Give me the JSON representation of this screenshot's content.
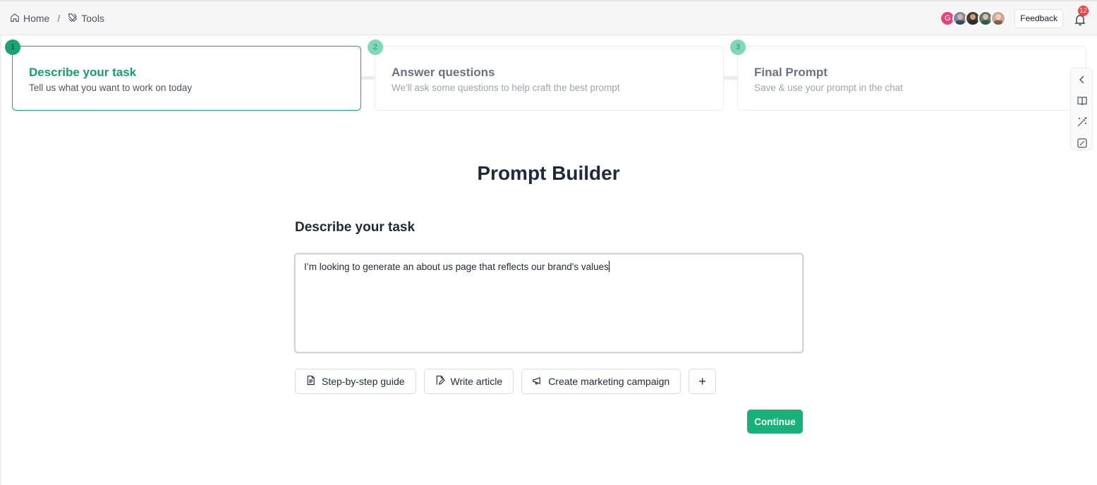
{
  "breadcrumb": {
    "home_label": "Home",
    "separator": "/",
    "tools_label": "Tools"
  },
  "header": {
    "avatars": [
      {
        "type": "letter",
        "text": "G",
        "color": "#e8437b"
      },
      {
        "type": "photo",
        "color": "#7a8aa0"
      },
      {
        "type": "photo",
        "color": "#4a3b2f"
      },
      {
        "type": "photo",
        "color": "#5a7d6e"
      },
      {
        "type": "photo",
        "color": "#c9a89a"
      }
    ],
    "feedback_label": "Feedback",
    "notification_count": "12"
  },
  "steps": [
    {
      "number": "1",
      "title": "Describe your task",
      "description": "Tell us what you want to work on today",
      "active": true
    },
    {
      "number": "2",
      "title": "Answer questions",
      "description": "We'll ask some questions to help craft the best prompt",
      "active": false
    },
    {
      "number": "3",
      "title": "Final Prompt",
      "description": "Save & use your prompt in the chat",
      "active": false
    }
  ],
  "side_tools": [
    "chevron-left-icon",
    "book-icon",
    "magic-wand-icon",
    "edit-square-icon"
  ],
  "main": {
    "title": "Prompt Builder",
    "section_title": "Describe your task",
    "task_text": "I’m looking to generate an about us page that reflects our brand's values",
    "chips": [
      {
        "label": "Step-by-step guide",
        "icon": "document-icon"
      },
      {
        "label": "Write article",
        "icon": "file-edit-icon"
      },
      {
        "label": "Create marketing campaign",
        "icon": "megaphone-icon"
      }
    ],
    "plus_label": "+",
    "continue_label": "Continue"
  },
  "colors": {
    "accent": "#17b27a",
    "active_step_text": "#1a9c72",
    "badge": "#ef4444"
  }
}
